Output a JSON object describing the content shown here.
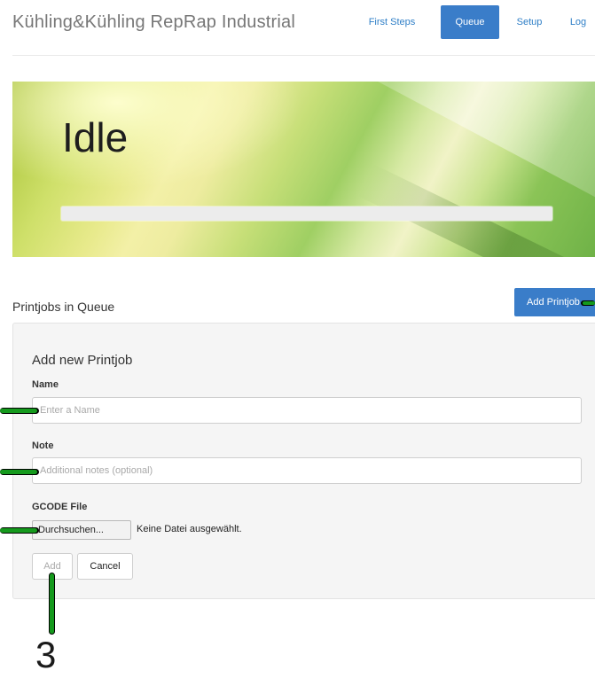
{
  "app": {
    "brand": "Kühling&Kühling RepRap Industrial"
  },
  "nav": {
    "items": [
      {
        "label": "First Steps",
        "active": false
      },
      {
        "label": "Queue",
        "active": true
      },
      {
        "label": "Setup",
        "active": false
      },
      {
        "label": "Log",
        "active": false
      }
    ]
  },
  "banner": {
    "status": "Idle",
    "progress_percent": 0
  },
  "queue": {
    "title": "Printjobs in Queue",
    "add_button": "Add Printjob"
  },
  "form": {
    "title": "Add new Printjob",
    "name_label": "Name",
    "name_placeholder": "Enter a Name",
    "note_label": "Note",
    "note_placeholder": "Additional notes (optional)",
    "file_label": "GCODE File",
    "file_button": "Durchsuchen...",
    "file_status": "Keine Datei ausgewählt.",
    "add_button": "Add",
    "cancel_button": "Cancel"
  },
  "annotation": {
    "number": "3"
  },
  "colors": {
    "accent": "#3a7dc9",
    "annotation": "#159a1d"
  }
}
